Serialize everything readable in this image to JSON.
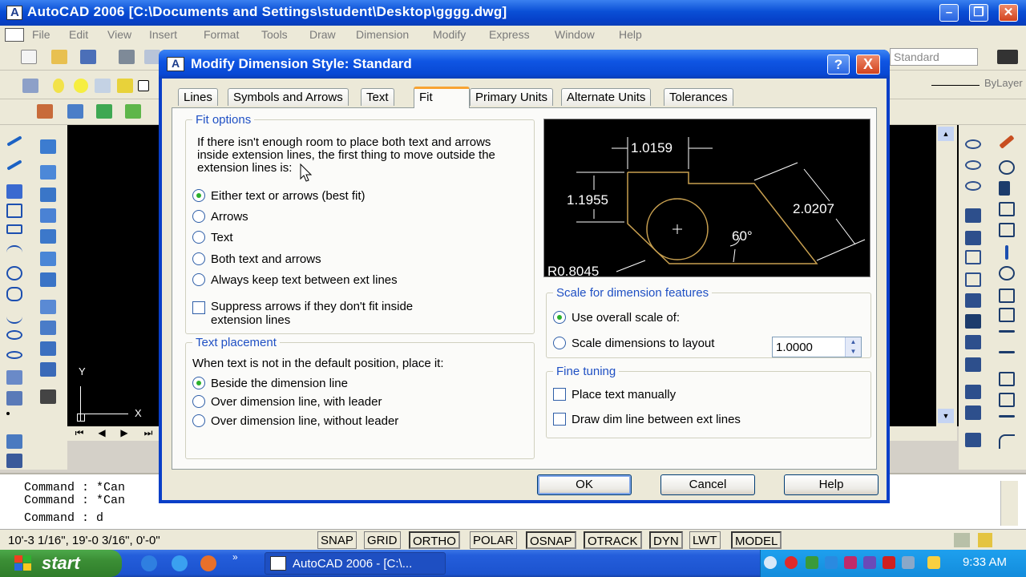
{
  "app": {
    "title": "AutoCAD 2006   [C:\\Documents and Settings\\student\\Desktop\\gggg.dwg]",
    "menu": [
      "File",
      "Edit",
      "View",
      "Insert",
      "Format",
      "Tools",
      "Draw",
      "Dimension",
      "Modify",
      "Express",
      "Window",
      "Help"
    ],
    "layer_combo": "ByLayer",
    "std_combo": "Standard",
    "ucs_y": "Y",
    "ucs_x": "X"
  },
  "dialog": {
    "title": "Modify Dimension Style: Standard",
    "help_btn": "?",
    "close_btn": "X",
    "tabs": [
      "Lines",
      "Symbols and Arrows",
      "Text",
      "Fit",
      "Primary Units",
      "Alternate Units",
      "Tolerances"
    ],
    "active_tab": "Fit",
    "fit_options": {
      "label": "Fit options",
      "description": "If there isn't enough room to place both text and arrows inside extension lines, the first thing to move outside the extension lines is:",
      "radios": [
        {
          "label": "Either text or arrows (best fit)",
          "selected": true
        },
        {
          "label": "Arrows",
          "selected": false
        },
        {
          "label": "Text",
          "selected": false
        },
        {
          "label": "Both text and arrows",
          "selected": false
        },
        {
          "label": "Always keep text between ext lines",
          "selected": false
        }
      ],
      "suppress_checkbox": "Suppress arrows if they don't fit inside extension lines"
    },
    "text_placement": {
      "label": "Text placement",
      "description": "When text is not in the default position, place it:",
      "radios": [
        {
          "label": "Beside the dimension line",
          "selected": true
        },
        {
          "label": "Over dimension line, with leader",
          "selected": false
        },
        {
          "label": "Over dimension line, without leader",
          "selected": false
        }
      ]
    },
    "preview": {
      "dim_top": "1.0159",
      "dim_left": "1.1955",
      "dim_right": "2.0207",
      "angle": "60°",
      "radius": "R0.8045"
    },
    "scale": {
      "label": "Scale for dimension features",
      "overall_label": "Use overall scale of:",
      "overall_value": "1.0000",
      "layout_label": "Scale dimensions to layout"
    },
    "fine_tuning": {
      "label": "Fine tuning",
      "manual": "Place text manually",
      "draw_dim": "Draw dim line between ext lines"
    },
    "buttons": {
      "ok": "OK",
      "cancel": "Cancel",
      "help": "Help"
    }
  },
  "command": {
    "lines": [
      "Command :  *Can",
      "Command :  *Can",
      "Command :  d"
    ]
  },
  "status": {
    "coords": "10'-3 1/16\",  19'-0 3/16\",  0'-0\"",
    "buttons": [
      "SNAP",
      "GRID",
      "ORTHO",
      "POLAR",
      "OSNAP",
      "OTRACK",
      "DYN",
      "LWT",
      "MODEL"
    ]
  },
  "taskbar": {
    "start": "start",
    "task": "AutoCAD 2006 - [C:\\...",
    "time": "9:33 AM"
  }
}
